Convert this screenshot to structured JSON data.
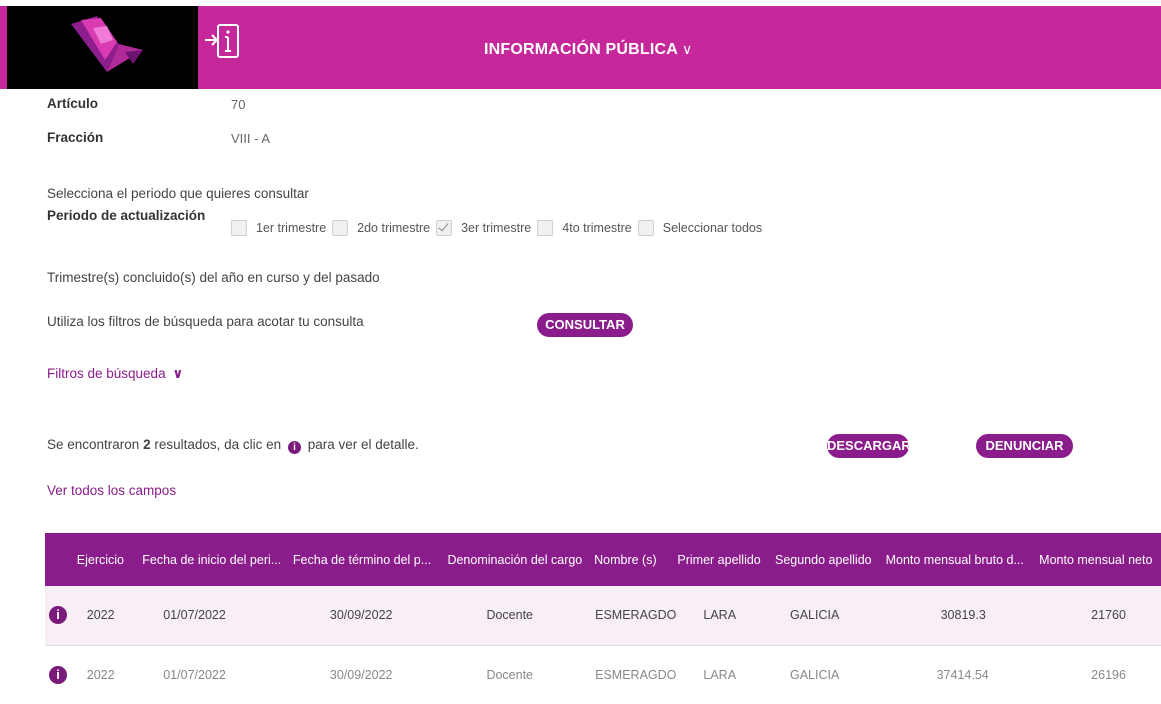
{
  "header": {
    "title": "INFORMACIÓN PÚBLICA",
    "brand_color": "#c6279a",
    "accent_color": "#8b1c8b"
  },
  "meta": {
    "articulo_label": "Artículo",
    "articulo_value": "70",
    "fraccion_label": "Fracción",
    "fraccion_value": "VIII - A"
  },
  "periodo": {
    "prompt": "Selecciona el periodo que quieres consultar",
    "label": "Periodo de actualización",
    "options": [
      {
        "label": "1er trimestre",
        "checked": false
      },
      {
        "label": "2do trimestre",
        "checked": false
      },
      {
        "label": "3er trimestre",
        "checked": true
      },
      {
        "label": "4to trimestre",
        "checked": false
      },
      {
        "label": "Seleccionar todos",
        "checked": false
      }
    ],
    "note": "Trimestre(s) concluido(s) del año en curso y del pasado"
  },
  "filters": {
    "hint": "Utiliza los filtros de búsqueda para acotar tu consulta",
    "consultar_label": "CONSULTAR",
    "toggle_label": "Filtros de búsqueda"
  },
  "results": {
    "prefix": "Se encontraron",
    "count": "2",
    "middle": "resultados, da clic en",
    "suffix": "para ver el detalle.",
    "descargar_label": "DESCARGAR",
    "denunciar_label": "DENUNCIAR",
    "ver_todos_label": "Ver todos los campos"
  },
  "table": {
    "columns": [
      "Ejercicio",
      "Fecha de inicio del peri...",
      "Fecha de término del p...",
      "Denominación del cargo",
      "Nombre (s)",
      "Primer apellido",
      "Segundo apellido",
      "Monto mensual bruto d...",
      "Monto mensual neto"
    ],
    "rows": [
      [
        "2022",
        "01/07/2022",
        "30/09/2022",
        "Docente",
        "ESMERAGDO",
        "LARA",
        "GALICIA",
        "30819.3",
        "21760"
      ],
      [
        "2022",
        "01/07/2022",
        "30/09/2022",
        "Docente",
        "ESMERAGDO",
        "LARA",
        "GALICIA",
        "37414.54",
        "26196"
      ]
    ]
  }
}
